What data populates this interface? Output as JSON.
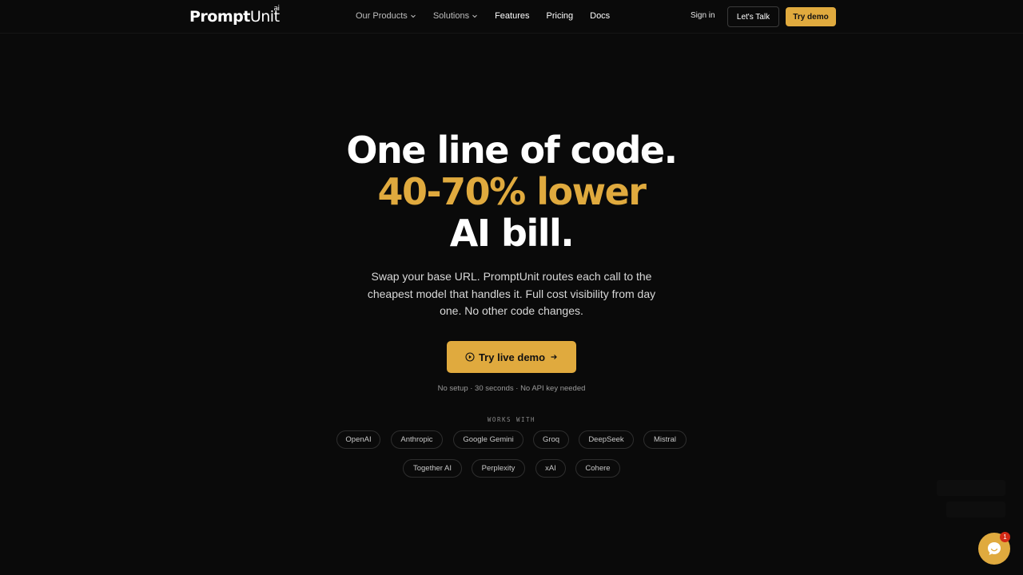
{
  "nav": {
    "logo_main": "Prompt",
    "logo_unit": "Unit",
    "logo_sup": "ai",
    "links": [
      {
        "label": "Our Products",
        "has_dropdown": true
      },
      {
        "label": "Solutions",
        "has_dropdown": true
      },
      {
        "label": "Features",
        "has_dropdown": false
      },
      {
        "label": "Pricing",
        "has_dropdown": false
      },
      {
        "label": "Docs",
        "has_dropdown": false
      }
    ],
    "sign_in": "Sign in",
    "lets_talk": "Let's Talk",
    "try_demo": "Try demo"
  },
  "hero": {
    "line1": "One line of code.",
    "line2": "40-70% lower",
    "line3": "AI bill.",
    "subtext": "Swap your base URL. PromptUnit routes each call to the cheapest model that handles it. Full cost visibility from day one. No other code changes.",
    "cta_label": "Try live demo",
    "note": "No setup · 30 seconds · No API key needed"
  },
  "works_with": {
    "label": "WORKS WITH",
    "providers": [
      "OpenAI",
      "Anthropic",
      "Google Gemini",
      "Groq",
      "DeepSeek",
      "Mistral",
      "Together AI",
      "Perplexity",
      "xAI",
      "Cohere"
    ]
  },
  "chat": {
    "badge_count": "1"
  },
  "colors": {
    "accent": "#e0aa3e",
    "background": "#0a0a0a",
    "badge": "#d22a16"
  }
}
